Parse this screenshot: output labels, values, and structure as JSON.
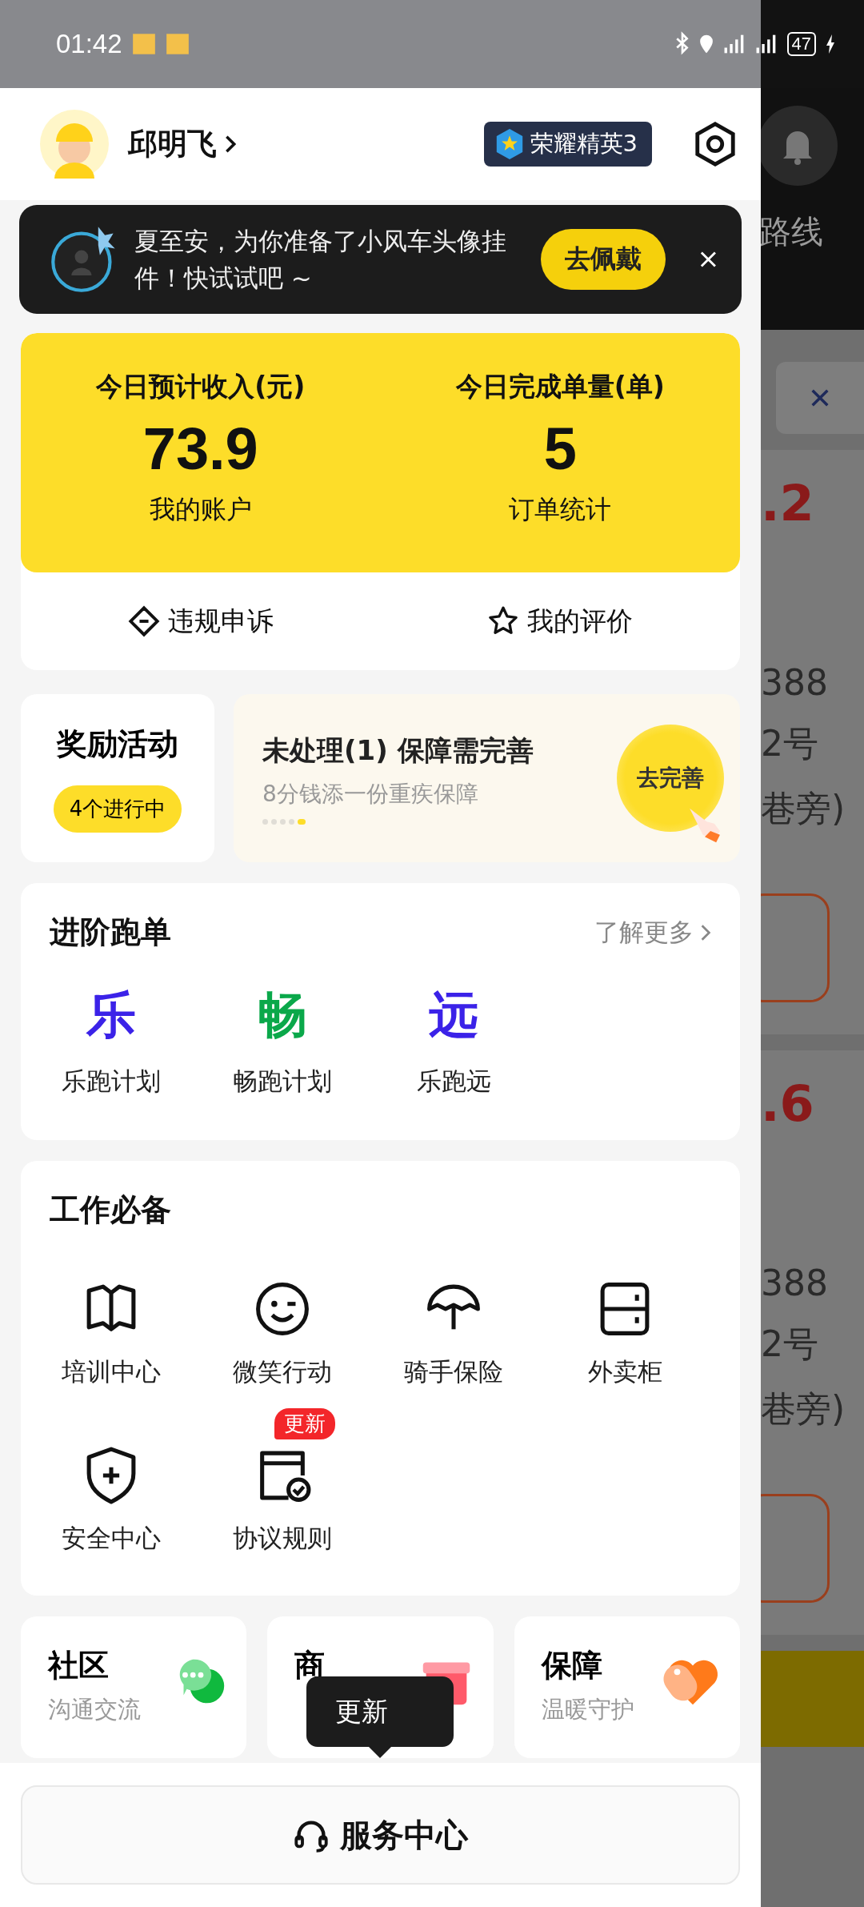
{
  "status_bar": {
    "time": "01:42",
    "battery": "47"
  },
  "header": {
    "name": "邱明飞",
    "level_badge": "荣耀精英3"
  },
  "banner": {
    "text": "夏至安，为你准备了小风车头像挂件！快试试吧 ~",
    "button": "去佩戴"
  },
  "earnings": {
    "stats": [
      {
        "label": "今日预计收入(元)",
        "value": "73.9",
        "link": "我的账户"
      },
      {
        "label": "今日完成单量(单)",
        "value": "5",
        "link": "订单统计"
      }
    ],
    "actions": [
      {
        "kind": "appeal",
        "label": "违规申诉"
      },
      {
        "kind": "rating",
        "label": "我的评价"
      }
    ]
  },
  "rewards": {
    "title": "奖励活动",
    "badge": "4个进行中"
  },
  "promo": {
    "title": "未处理(1) 保障需完善",
    "subtitle": "8分钱添一份重疾保障",
    "button": "去完善",
    "dots": [
      {
        "selected": false
      },
      {
        "selected": false
      },
      {
        "selected": false
      },
      {
        "selected": false
      },
      {
        "selected": true
      }
    ]
  },
  "advanced": {
    "title": "进阶跑单",
    "more": "了解更多",
    "items": [
      {
        "glyph": "乐",
        "color": "#3b22e8",
        "label": "乐跑计划"
      },
      {
        "glyph": "畅",
        "color": "#0aa84a",
        "label": "畅跑计划"
      },
      {
        "glyph": "远",
        "color": "#3b22e8",
        "label": "乐跑远"
      }
    ]
  },
  "work": {
    "title": "工作必备",
    "items": [
      {
        "kind": "book",
        "label": "培训中心"
      },
      {
        "kind": "smile",
        "label": "微笑行动"
      },
      {
        "kind": "umbrella",
        "label": "骑手保险"
      },
      {
        "kind": "locker",
        "label": "外卖柜"
      },
      {
        "kind": "shield",
        "label": "安全中心"
      },
      {
        "kind": "document",
        "label": "协议规则",
        "badge": "更新"
      }
    ]
  },
  "shortcuts": [
    {
      "kind": "chat",
      "title": "社区",
      "subtitle": "沟通交流"
    },
    {
      "kind": "gift",
      "title": "商"
    },
    {
      "kind": "heart",
      "title": "保障",
      "subtitle": "温暖守护"
    }
  ],
  "tooltip": "更新",
  "service_button": "服务中心",
  "background_page": {
    "header_text": "路线",
    "orders": [
      {
        "amount": ".2",
        "lines": [
          "388",
          "2号",
          "巷旁)"
        ]
      },
      {
        "amount": ".6",
        "lines": [
          "388",
          "2号",
          "巷旁)"
        ]
      }
    ]
  }
}
